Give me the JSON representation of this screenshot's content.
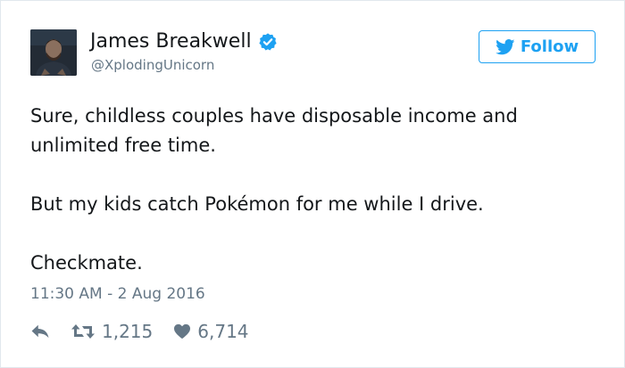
{
  "tweet": {
    "author": {
      "display_name": "James Breakwell",
      "handle": "@XplodingUnicorn",
      "verified": true,
      "avatar_icon": "user-avatar-photo"
    },
    "follow_button": {
      "label": "Follow",
      "icon": "twitter-bird-icon",
      "accent_color": "#1da1f2"
    },
    "text_paragraphs": [
      "Sure, childless couples have disposable income and unlimited free time.",
      "But my kids catch Pokémon for me while I drive.",
      "Checkmate."
    ],
    "timestamp": "11:30 AM - 2 Aug 2016",
    "actions": {
      "reply": {
        "icon": "reply-icon"
      },
      "retweet": {
        "icon": "retweet-icon",
        "count": "1,215"
      },
      "like": {
        "icon": "heart-icon",
        "count": "6,714"
      }
    }
  },
  "colors": {
    "text_primary": "#14171a",
    "text_secondary": "#657786",
    "verified_badge": "#1da1f2",
    "border": "#e1e8ed"
  }
}
